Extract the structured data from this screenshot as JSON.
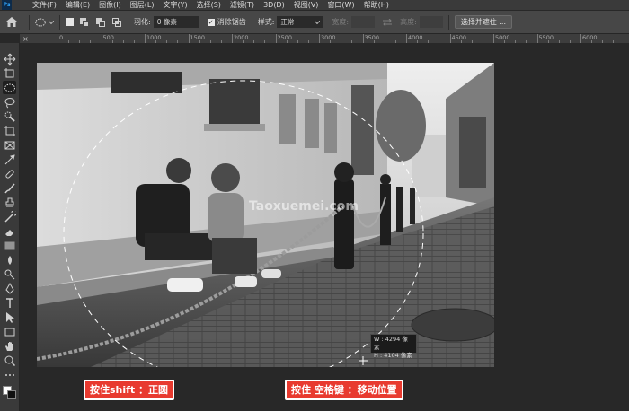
{
  "app": {
    "logo_text": "Ps"
  },
  "menu": {
    "items": [
      "文件(F)",
      "编辑(E)",
      "图像(I)",
      "图层(L)",
      "文字(Y)",
      "选择(S)",
      "滤镜(T)",
      "3D(D)",
      "视图(V)",
      "窗口(W)",
      "帮助(H)"
    ]
  },
  "options": {
    "feather_label": "羽化:",
    "feather_value": "0 像素",
    "antialias_label": "消除锯齿",
    "antialias_checked": true,
    "style_label": "样式:",
    "style_value": "正常",
    "width_label": "宽度:",
    "height_label": "高度:",
    "select_mask_button": "选择并遮住 ..."
  },
  "ruler": {
    "labels": [
      "0",
      "500",
      "1000",
      "1500",
      "2000",
      "2500",
      "3000",
      "3500",
      "4000",
      "4500",
      "5000",
      "5500",
      "6000"
    ]
  },
  "tools": [
    {
      "name": "move-tool-icon"
    },
    {
      "name": "artboard-tool-icon"
    },
    {
      "name": "elliptical-marquee-tool-icon",
      "active": true
    },
    {
      "name": "lasso-tool-icon"
    },
    {
      "name": "quick-selection-tool-icon"
    },
    {
      "name": "crop-tool-icon"
    },
    {
      "name": "frame-tool-icon"
    },
    {
      "name": "eyedropper-tool-icon"
    },
    {
      "name": "healing-brush-tool-icon"
    },
    {
      "name": "brush-tool-icon"
    },
    {
      "name": "clone-stamp-tool-icon"
    },
    {
      "name": "history-brush-tool-icon"
    },
    {
      "name": "eraser-tool-icon"
    },
    {
      "name": "gradient-tool-icon"
    },
    {
      "name": "blur-tool-icon"
    },
    {
      "name": "dodge-tool-icon"
    },
    {
      "name": "pen-tool-icon"
    },
    {
      "name": "type-tool-icon"
    },
    {
      "name": "path-selection-tool-icon"
    },
    {
      "name": "rectangle-tool-icon"
    },
    {
      "name": "hand-tool-icon"
    },
    {
      "name": "zoom-tool-icon"
    },
    {
      "name": "more-tools-icon"
    }
  ],
  "canvas": {
    "watermark": "Taoxuemei.com",
    "measure_w_label": "W :",
    "measure_w_value": "4294 像素",
    "measure_h_label": "H :",
    "measure_h_value": "4104 像素"
  },
  "annotations": {
    "shift_hint": "按住shift ：正圆",
    "space_hint": "按住 空格键 ：移动位置"
  },
  "colors": {
    "annotation_bg": "#e83a2f",
    "foreground": "#ffffff",
    "background": "#111111"
  }
}
